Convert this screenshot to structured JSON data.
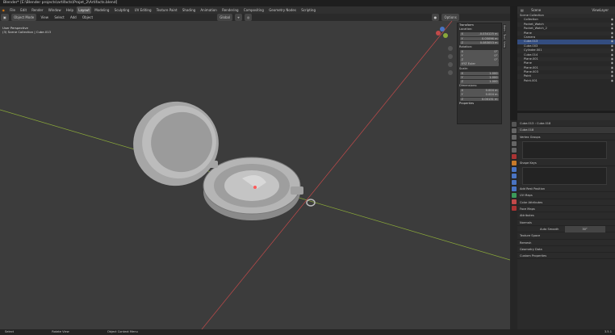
{
  "titlebar": {
    "title": "Blender* [E:\\Blender projects\\artifacts\\Projet_2\\Artifacts.blend]"
  },
  "menu": [
    "File",
    "Edit",
    "Render",
    "Window",
    "Help"
  ],
  "workspaces": [
    {
      "label": "Layout",
      "active": true
    },
    {
      "label": "Modeling"
    },
    {
      "label": "Sculpting"
    },
    {
      "label": "UV Editing"
    },
    {
      "label": "Texture Paint"
    },
    {
      "label": "Shading"
    },
    {
      "label": "Animation"
    },
    {
      "label": "Rendering"
    },
    {
      "label": "Compositing"
    },
    {
      "label": "Geometry Nodes"
    },
    {
      "label": "Scripting"
    }
  ],
  "scene": {
    "label": "Scene",
    "view_layer": "ViewLayer"
  },
  "viewport_header": {
    "mode": "Object Mode",
    "menus": [
      "View",
      "Select",
      "Add",
      "Object"
    ],
    "transform": "Global",
    "options": "Options"
  },
  "viewport_overlay": {
    "line1": "User Perspective",
    "line2": "(3) Scene Collection | Cube.013"
  },
  "npanel": {
    "tabs": [
      "Item",
      "Tool",
      "View"
    ],
    "transform_title": "Transform",
    "location_label": "Location:",
    "location": [
      {
        "axis": "X",
        "value": "-0.034125 m"
      },
      {
        "axis": "Y",
        "value": "0.05096 m"
      },
      {
        "axis": "Z",
        "value": "0.083053 m"
      }
    ],
    "rotation_label": "Rotation:",
    "rotation": [
      {
        "axis": "X",
        "value": "0°"
      },
      {
        "axis": "Y",
        "value": "0°"
      },
      {
        "axis": "Z",
        "value": "0°"
      }
    ],
    "rotation_mode": "XYZ Euler",
    "scale_label": "Scale:",
    "scale": [
      {
        "axis": "X",
        "value": "1.000"
      },
      {
        "axis": "Y",
        "value": "1.000"
      },
      {
        "axis": "Z",
        "value": "1.000"
      }
    ],
    "dimensions_label": "Dimensions:",
    "dimensions": [
      {
        "axis": "X",
        "value": "0.004 m"
      },
      {
        "axis": "Y",
        "value": "0.004 m"
      },
      {
        "axis": "Z",
        "value": "0.00131 m"
      }
    ],
    "properties_title": "Properties"
  },
  "outliner": {
    "items": [
      {
        "label": "Scene Collection",
        "sel": false
      },
      {
        "label": "Collection",
        "sel": false
      },
      {
        "label": "Pocket_Watch",
        "sel": false
      },
      {
        "label": "Pocket_Watch_2",
        "sel": false
      },
      {
        "label": "Plane",
        "sel": false
      },
      {
        "label": "Camera",
        "sel": false
      },
      {
        "label": "Cube.013",
        "sel": true
      },
      {
        "label": "Cube.003",
        "sel": false
      },
      {
        "label": "Cylinder.001",
        "sel": false
      },
      {
        "label": "Cube.014",
        "sel": false
      },
      {
        "label": "Plane.001",
        "sel": false
      },
      {
        "label": "Plane",
        "sel": false
      },
      {
        "label": "Plane.001",
        "sel": false
      },
      {
        "label": "Plane.003",
        "sel": false
      },
      {
        "label": "Point",
        "sel": false
      },
      {
        "label": "Point.001",
        "sel": false
      }
    ]
  },
  "properties": {
    "object": "Cube.013",
    "mesh": "Cube.018",
    "sections": [
      "Vertex Groups",
      "Shape Keys",
      "Add Rest Position",
      "UV Maps",
      "Color Attributes",
      "Face Maps",
      "Attributes",
      "Normals",
      "Auto Smooth",
      "Texture Space",
      "Remesh",
      "Geometry Data",
      "Custom Properties"
    ],
    "auto_smooth_value": "30°"
  },
  "statusbar": {
    "items": [
      "Select",
      "Rotate View",
      "Object Context Menu"
    ],
    "version": "3.5.1"
  },
  "colors": {
    "viewport_bg": "#3c3c3c",
    "x_axis": "#c24a4a",
    "y_axis": "#8aa83a",
    "selected": "#334d80"
  }
}
